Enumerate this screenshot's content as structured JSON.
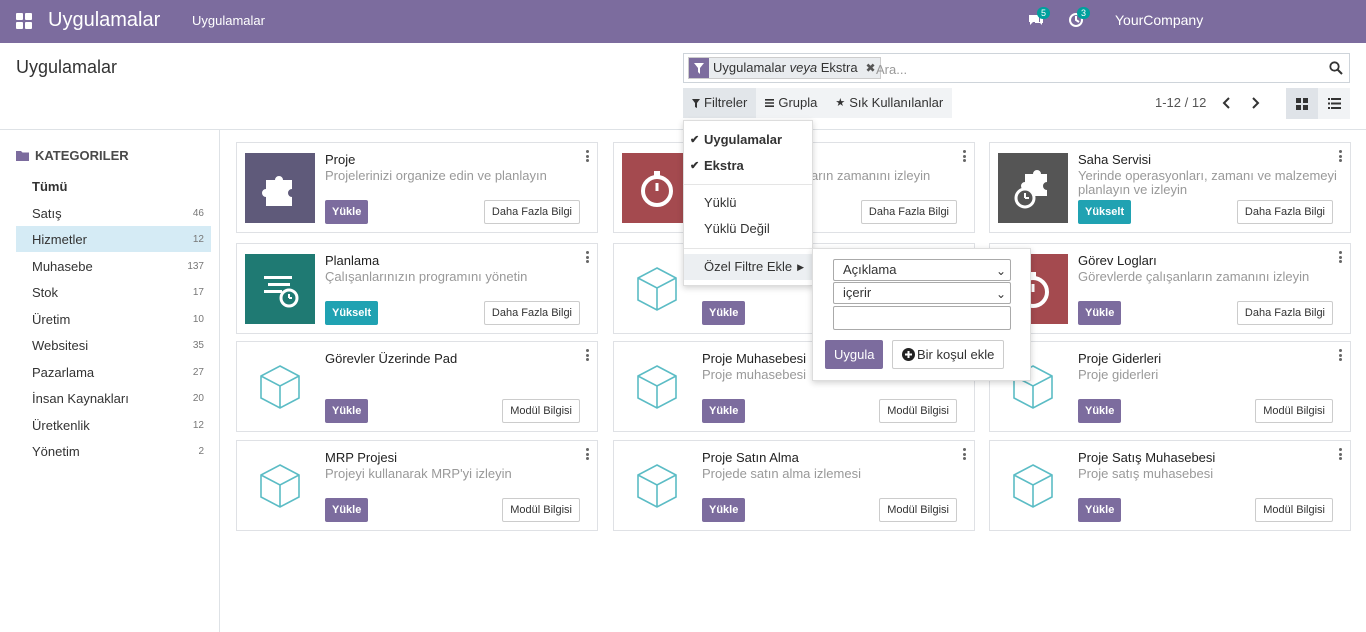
{
  "topbar": {
    "brand": "Uygulamalar",
    "menu": "Uygulamalar",
    "messages_count": "5",
    "activities_count": "3",
    "company": "YourCompany"
  },
  "control_panel": {
    "title": "Uygulamalar",
    "facet": {
      "part1": "Uygulamalar",
      "connector": "veya",
      "part2": "Ekstra"
    },
    "search_placeholder": "Ara...",
    "filters_label": "Filtreler",
    "groupby_label": "Grupla",
    "favorites_label": "Sık Kullanılanlar",
    "pager": "1-12 / 12"
  },
  "sidebar": {
    "heading": "KATEGORILER",
    "items": [
      {
        "label": "Tümü",
        "count": ""
      },
      {
        "label": "Satış",
        "count": "46"
      },
      {
        "label": "Hizmetler",
        "count": "12"
      },
      {
        "label": "Muhasebe",
        "count": "137"
      },
      {
        "label": "Stok",
        "count": "17"
      },
      {
        "label": "Üretim",
        "count": "10"
      },
      {
        "label": "Websitesi",
        "count": "35"
      },
      {
        "label": "Pazarlama",
        "count": "27"
      },
      {
        "label": "İnsan Kaynakları",
        "count": "20"
      },
      {
        "label": "Üretkenlik",
        "count": "12"
      },
      {
        "label": "Yönetim",
        "count": "2"
      }
    ]
  },
  "filter_dropdown": {
    "items": [
      "Uygulamalar",
      "Ekstra",
      "Yüklü",
      "Yüklü Değil"
    ],
    "custom_filter": "Özel Filtre Ekle"
  },
  "custom_filter": {
    "field": "Açıklama",
    "operator": "içerir",
    "apply": "Uygula",
    "add_condition": "Bir koşul ekle"
  },
  "cards": [
    {
      "name": "Proje",
      "desc": "Projelerinizi organize edin ve planlayın",
      "primary": "Yükle",
      "secondary": "Daha Fazla Bilgi"
    },
    {
      "name": "",
      "desc": "arın zamanını izleyin",
      "primary": "",
      "secondary": "Daha Fazla Bilgi"
    },
    {
      "name": "Saha Servisi",
      "desc": "Yerinde operasyonları, zamanı ve malzemeyi planlayın ve izleyin",
      "primary": "Yükselt",
      "secondary": "Daha Fazla Bilgi"
    },
    {
      "name": "Planlama",
      "desc": "Çalışanlarınızın programını yönetin",
      "primary": "Yükselt",
      "secondary": "Daha Fazla Bilgi"
    },
    {
      "name": "",
      "desc": "",
      "primary": "Yükle",
      "secondary": ""
    },
    {
      "name": "Görev Logları",
      "desc": "Görevlerde çalışanların zamanını izleyin",
      "primary": "Yükle",
      "secondary": "Daha Fazla Bilgi"
    },
    {
      "name": "Görevler Üzerinde Pad",
      "desc": "",
      "primary": "Yükle",
      "secondary": "Modül Bilgisi"
    },
    {
      "name": "Proje Muhasebesi",
      "desc": "Proje muhasebesi",
      "primary": "Yükle",
      "secondary": "Modül Bilgisi"
    },
    {
      "name": "Proje Giderleri",
      "desc": "Proje giderleri",
      "primary": "Yükle",
      "secondary": "Modül Bilgisi"
    },
    {
      "name": "MRP Projesi",
      "desc": "Projeyi kullanarak MRP'yi izleyin",
      "primary": "Yükle",
      "secondary": "Modül Bilgisi"
    },
    {
      "name": "Proje Satın Alma",
      "desc": "Projede satın alma izlemesi",
      "primary": "Yükle",
      "secondary": "Modül Bilgisi"
    },
    {
      "name": "Proje Satış Muhasebesi",
      "desc": "Proje satış muhasebesi",
      "primary": "Yükle",
      "secondary": "Modül Bilgisi"
    }
  ],
  "colors": {
    "brand": "#7c6c9e",
    "upgrade": "#20a2b2",
    "active_category": "#d5ebf5"
  }
}
